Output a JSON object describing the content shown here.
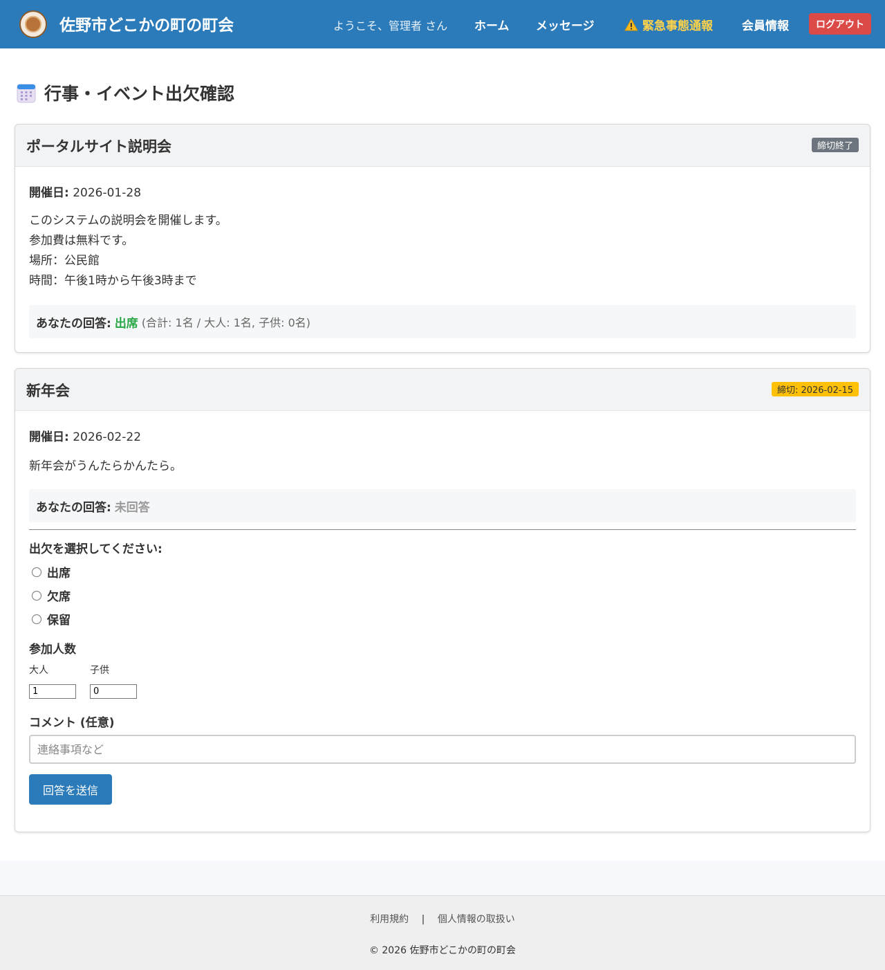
{
  "header": {
    "site_title": "佐野市どこかの町の町会",
    "welcome": "ようこそ、管理者 さん",
    "nav": {
      "home": "ホーム",
      "messages": "メッセージ",
      "emergency": "緊急事態通報",
      "member_info": "会員情報",
      "logout": "ログアウト"
    }
  },
  "page": {
    "title": "行事・イベント出欠確認"
  },
  "events": [
    {
      "title": "ポータルサイト説明会",
      "badge": "締切終了",
      "date_label": "開催日:",
      "date": "2026-01-28",
      "description": [
        "このシステムの説明会を開催します。",
        "参加費は無料です。",
        "場所：公民館",
        "時間：午後1時から午後3時まで"
      ],
      "answer_label": "あなたの回答:",
      "answer": "出席",
      "answer_detail": "(合計: 1名 / 大人: 1名, 子供: 0名)"
    },
    {
      "title": "新年会",
      "badge": "締切: 2026-02-15",
      "date_label": "開催日:",
      "date": "2026-02-22",
      "description": [
        "新年会がうんたらかんたら。"
      ],
      "answer_label": "あなたの回答:",
      "answer": "未回答"
    }
  ],
  "form": {
    "attendance_prompt": "出欠を選択してください:",
    "options": [
      "出席",
      "欠席",
      "保留"
    ],
    "count_label": "参加人数",
    "adult_label": "大人",
    "child_label": "子供",
    "adult_value": "1",
    "child_value": "0",
    "comment_label": "コメント (任意)",
    "comment_placeholder": "連絡事項など",
    "submit": "回答を送信"
  },
  "footer": {
    "terms": "利用規約",
    "separator": "|",
    "privacy": "個人情報の取扱い",
    "copyright": "© 2026 佐野市どこかの町の町会"
  },
  "colors": {
    "header_bg": "#2b7bba",
    "emergency": "#ffd24a",
    "logout_bg": "#dc4a48",
    "present": "#28a745",
    "deadline_badge": "#ffc107",
    "closed_badge": "#6c757d"
  }
}
